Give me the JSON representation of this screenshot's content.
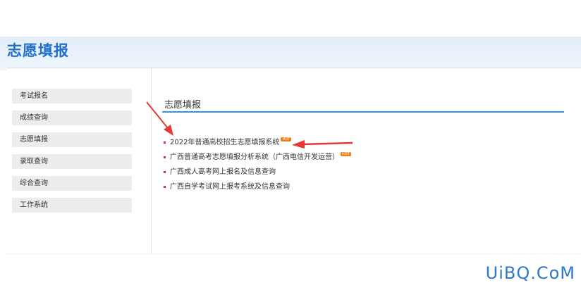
{
  "header": {
    "title": "志愿填报"
  },
  "sidebar": {
    "items": [
      {
        "label": "考试报名"
      },
      {
        "label": "成绩查询"
      },
      {
        "label": "志愿填报"
      },
      {
        "label": "录取查询"
      },
      {
        "label": "综合查询"
      },
      {
        "label": "工作系统"
      }
    ]
  },
  "main": {
    "title": "志愿填报",
    "links": [
      {
        "label": "2022年普通高校招生志愿填报系统",
        "badge": "HOT"
      },
      {
        "label": "广西普通高考志愿填报分析系统（广西电信开发运营）",
        "badge": "HOT"
      },
      {
        "label": "广西成人高考网上报名及信息查询"
      },
      {
        "label": "广西自学考试网上报考系统及信息查询"
      }
    ]
  },
  "watermark": "UiBQ.CoM",
  "colors": {
    "accent": "#3b8fdc",
    "annotation_arrow": "#e53935",
    "badge": "#f07c1a"
  }
}
